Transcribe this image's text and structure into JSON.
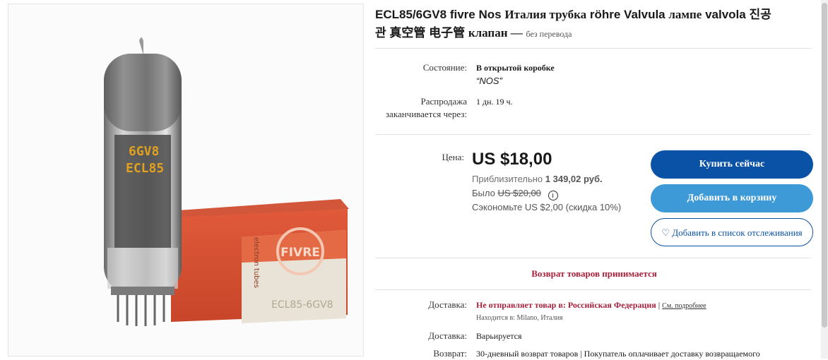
{
  "title": {
    "main": "ECL85/6GV8 fivre Nos",
    "italia": "Италия трубка",
    "rohre": "röhre Valvula",
    "lampe": "лампе",
    "valvola": "valvola 진공",
    "line2": "관 真空管 电子管",
    "klapan": "клапан —",
    "no_translation": "без перевода"
  },
  "condition": {
    "label": "Состояние:",
    "value": "В открытой коробке",
    "note": "“NOS”"
  },
  "sale_end": {
    "label_line1": "Распродажа",
    "label_line2": "заканчивается через:",
    "value": "1 дн. 19 ч."
  },
  "price": {
    "label": "Цена:",
    "value": "US $18,00",
    "approx_prefix": "Приблизительно",
    "approx_value": "1 349,02 руб.",
    "was_prefix": "Было",
    "was_value": "US $20,00",
    "info_icon_glyph": "i",
    "savings": "Сэкономьте US $2,00 (скидка 10%)"
  },
  "buttons": {
    "buy_now": "Купить сейчас",
    "add_to_cart": "Добавить в корзину",
    "watchlist_icon": "♡",
    "watchlist": "Добавить в список отслеживания"
  },
  "returns_banner": "Возврат товаров принимается",
  "shipping": {
    "label": "Доставка:",
    "value": "Не отправляет товар в: Российская Федерация",
    "separator": "|",
    "details_link": "См. подробнее",
    "location": "Находится в: Milano, Италия"
  },
  "delivery": {
    "label": "Доставка:",
    "value": "Варьируется"
  },
  "return_policy": {
    "label": "Возврат:",
    "value": "30-дневный возврат товаров | Покупатель оплачивает доставку возвращаемого"
  },
  "product_image": {
    "tube_print_1": "6GV8",
    "tube_print_2": "ECL85",
    "box_logo": "FIVRE",
    "box_side": "electron tubes",
    "box_code": "ECL85-6GV8"
  },
  "colors": {
    "buy_button": "#0a52a6",
    "cart_button": "#3d9ad6",
    "alert_red": "#a8203a"
  }
}
